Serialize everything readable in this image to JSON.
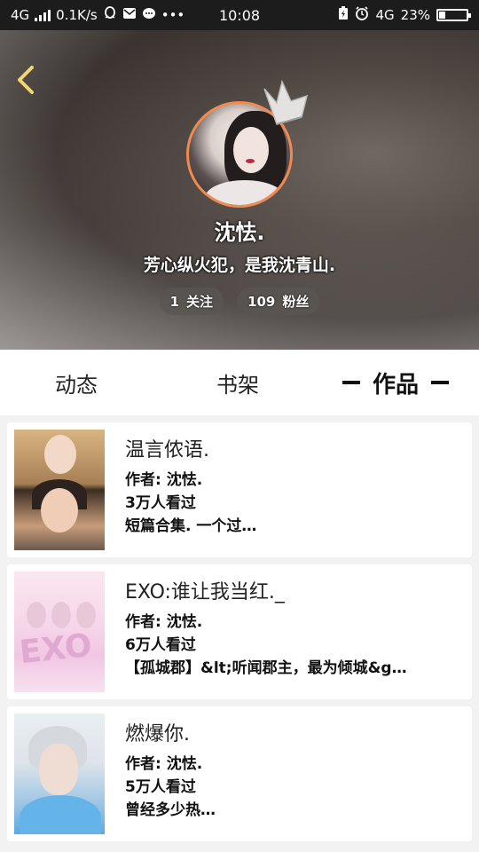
{
  "status_bar": {
    "network": "4G",
    "speed": "0.1K/s",
    "time": "10:08",
    "network_right": "4G",
    "battery_percent": "23%",
    "battery_level": 0.23,
    "icons": [
      "qq-icon",
      "mail-icon",
      "chat-icon",
      "more-dots-icon",
      "battery-saver-icon",
      "alarm-icon"
    ]
  },
  "profile": {
    "name": "沈怯.",
    "signature": "芳心纵火犯，是我沈青山.",
    "following_count": "1",
    "following_label": "关注",
    "followers_count": "109",
    "followers_label": "粉丝",
    "avatar_border_color": "#f08a4f"
  },
  "tabs": [
    {
      "label": "动态",
      "active": false
    },
    {
      "label": "书架",
      "active": false
    },
    {
      "label": "作品",
      "active": true
    }
  ],
  "works": [
    {
      "title": "温言侬语.",
      "author": "作者: 沈怯.",
      "views": "3万人看过",
      "desc": "短篇合集. 一个过…"
    },
    {
      "title": "EXO:谁让我当红._",
      "author": "作者: 沈怯.",
      "views": "6万人看过",
      "desc": "【孤城郡】&lt;听闻郡主，最为倾城&g…"
    },
    {
      "title": "燃爆你.",
      "author": "作者: 沈怯.",
      "views": "5万人看过",
      "desc": "曾经多少热…"
    }
  ]
}
